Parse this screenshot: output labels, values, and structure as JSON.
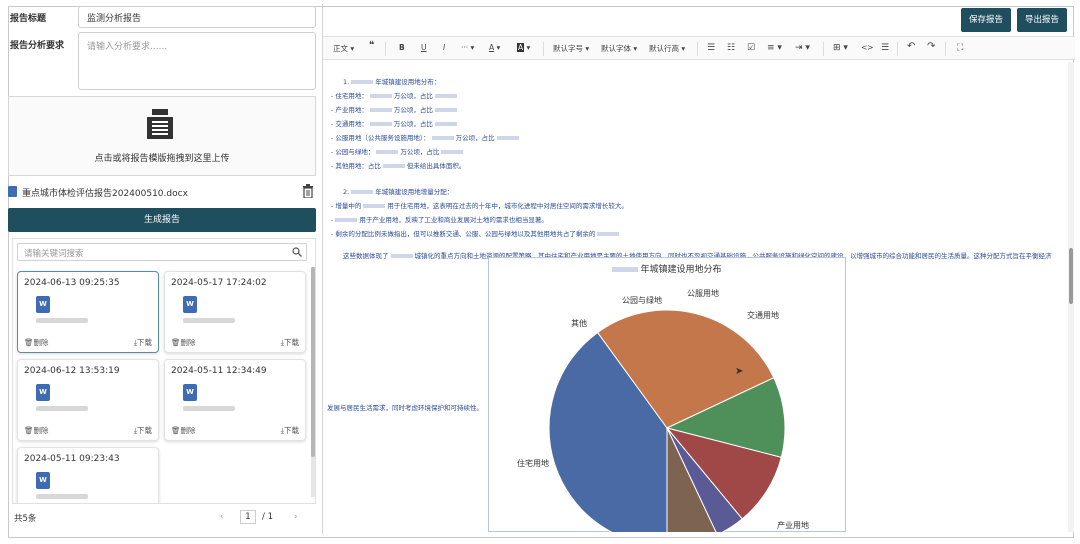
{
  "form": {
    "title_label": "报告标题",
    "title_value": "监测分析报告",
    "req_label": "报告分析要求",
    "req_placeholder": "请输入分析要求......",
    "upload_hint": "点击或将报告模版拖拽到这里上传",
    "file_name": "重点城市体检评估报告202400510.docx",
    "generate_label": "生成报告"
  },
  "history": {
    "search_placeholder": "请输关键词搜索",
    "cards": [
      {
        "date": "2024-06-13 09:25:35",
        "icon": "W",
        "delete": "删除",
        "download": "下载"
      },
      {
        "date": "2024-05-17 17:24:02",
        "icon": "W",
        "delete": "删除",
        "download": "下载"
      },
      {
        "date": "2024-06-12 13:53:19",
        "icon": "W",
        "delete": "删除",
        "download": "下载"
      },
      {
        "date": "2024-05-11 12:34:49",
        "icon": "W",
        "delete": "删除",
        "download": "下载"
      },
      {
        "date": "2024-05-11 09:23:43",
        "icon": "W"
      }
    ],
    "total": "共5条",
    "page": "1",
    "page_of": "/ 1",
    "prev": "‹",
    "next": "›"
  },
  "actions": {
    "save": "保存报告",
    "export": "导出报告"
  },
  "toolbar": {
    "para": "正文",
    "quote": "❝",
    "bold": "B",
    "underline": "U",
    "italic": "I",
    "more": "···",
    "font_color": "A",
    "bg_color": "A",
    "font_size": "默认字号",
    "font_family": "默认字体",
    "line_height": "默认行高",
    "bullet": "☰",
    "numbered": "☷",
    "todo": "☑",
    "align": "≡",
    "indent": "⇥",
    "table": "⊞",
    "code": "<>",
    "divider": "☰",
    "undo": "↶",
    "redo": "↷",
    "fullscreen": "⛶"
  },
  "editor": {
    "lines": [
      "1.",
      "年城镇建设用地分布：",
      "- 住宅用地：",
      "万公顷，占比",
      "- 产业用地：",
      "万公顷，占比",
      "- 交通用地：",
      "万公顷，占比",
      "- 公服用地（公共服务设施用地）：",
      "万公顷，占比",
      "- 公园与绿地：",
      "万公顷，占比",
      "- 其他用地：占比",
      "但未给出具体面积。",
      "2.",
      "年城镇建设用地增量分配：",
      "- 增量中的",
      "用于住宅用地，这表明在过去的十年中，城市化进程中对居住空间的需求增长较大。",
      "-",
      "用于产业用地，反映了工业和商业发展对土地的需求也相当显著。",
      "- 剩余的分配比例未做指出，但可以推断交通、公服、公园与绿地以及其他用地共占了剩余的",
      "这些数据体现了",
      "城镇化的重点方向和土地资源的配置策略，其中住宅和产业用地是主要的土地使用方向，同时也不忽视交通基础设施、公共服务设施和绿化空间的建设，以增强城市的综合功能和居民的生活质量。这种分配方式旨在平衡经济",
      "发展与居民生活需求，同时考虑环境保护和可持续性。"
    ]
  },
  "chart_data": {
    "type": "pie",
    "title": "年城镇建设用地分布",
    "categories": [
      "住宅用地",
      "产业用地",
      "交通用地",
      "公服用地",
      "公园与绿地",
      "其他"
    ],
    "values": [
      40,
      28,
      11,
      10,
      4,
      7
    ],
    "colors": [
      "#4a6aa5",
      "#c4774a",
      "#4f8f5a",
      "#a04848",
      "#5a5a96",
      "#7d6450"
    ]
  }
}
